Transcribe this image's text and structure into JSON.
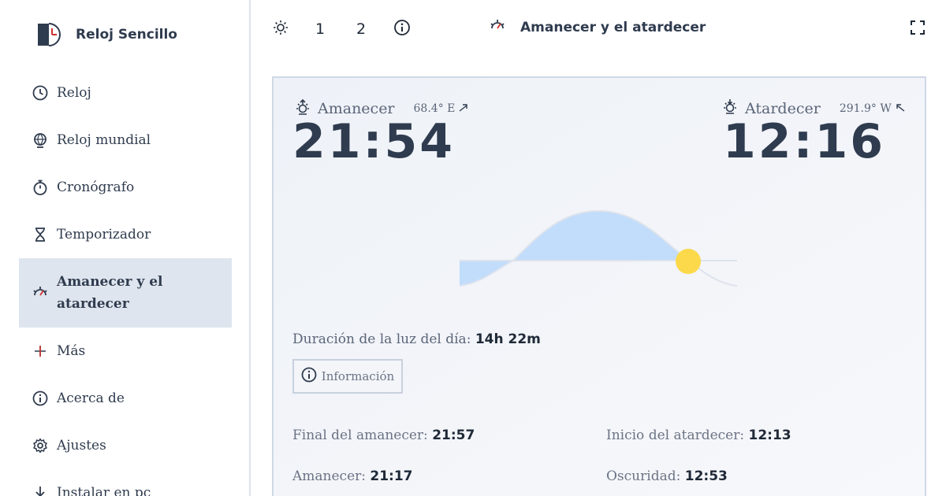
{
  "app": {
    "name": "Reloj Sencillo",
    "logo_icon": "clock-logo-icon"
  },
  "sidebar": {
    "items": [
      {
        "label": "Reloj",
        "icon": "clock-icon"
      },
      {
        "label": "Reloj mundial",
        "icon": "globe-clock-icon"
      },
      {
        "label": "Cronógrafo",
        "icon": "stopwatch-icon"
      },
      {
        "label": "Temporizador",
        "icon": "hourglass-icon"
      },
      {
        "label": "Amanecer y el atardecer",
        "icon": "sunrise-icon",
        "active": true
      },
      {
        "label": "Más",
        "icon": "plus-icon"
      },
      {
        "label": "Acerca de",
        "icon": "info-icon"
      },
      {
        "label": "Ajustes",
        "icon": "gear-icon"
      },
      {
        "label": "Instalar en pc",
        "icon": "download-icon"
      }
    ]
  },
  "toolbar": {
    "theme_icon": "sun-icon",
    "option1": "1",
    "option2": "2",
    "info_icon": "info-icon",
    "fullscreen_icon": "fullscreen-icon"
  },
  "header": {
    "title": "Amanecer y el atardecer",
    "icon": "sunrise-icon"
  },
  "sunrise": {
    "label": "Amanecer",
    "direction": "68.4° E",
    "time": "21:54"
  },
  "sunset": {
    "label": "Atardecer",
    "direction": "291.9° W",
    "time": "12:16"
  },
  "daylight": {
    "label": "Duración de la luz del día:",
    "value": "14h 22m"
  },
  "info_button": {
    "label": "Información"
  },
  "details": {
    "sunrise_end_label": "Final del amanecer:",
    "sunrise_end_value": "21:57",
    "sunset_start_label": "Inicio del atardecer:",
    "sunset_start_value": "12:13",
    "sunrise_label": "Amanecer:",
    "sunrise_value": "21:17",
    "dark_label": "Oscuridad:",
    "dark_value": "12:53"
  },
  "colors": {
    "accent": "#2f3b4e",
    "daylight_fill": "#c2dcfb",
    "sun": "#fcd94a",
    "active_bg": "#dfe5ee"
  }
}
